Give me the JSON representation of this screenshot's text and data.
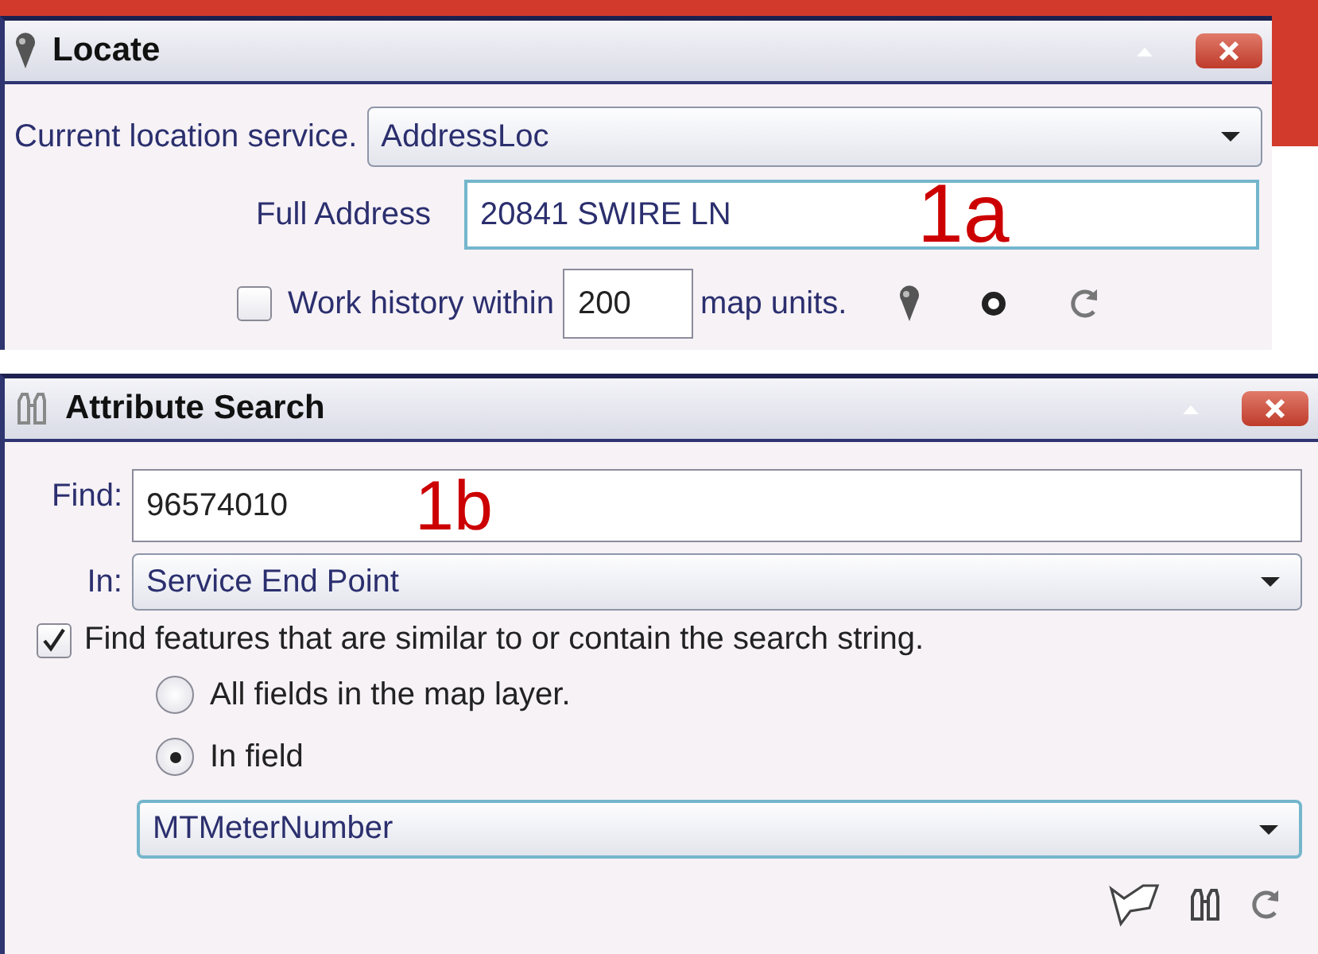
{
  "locate": {
    "title": "Locate",
    "service_label": "Current location service.",
    "service": "AddressLoc",
    "address_label": "Full Address",
    "address": "20841 SWIRE LN",
    "annotation": "1a",
    "history": {
      "checked": false,
      "label": "Work history within",
      "value": "200",
      "units": "map units."
    }
  },
  "attribute_search": {
    "title": "Attribute Search",
    "find_label": "Find:",
    "find": "96574010",
    "annotation": "1b",
    "in_label": "In:",
    "layer": "Service End Point",
    "similar": {
      "checked": true,
      "label": "Find features that are similar to or contain the search string."
    },
    "scope": [
      {
        "label": "All fields in the map layer.",
        "selected": false
      },
      {
        "label": "In field",
        "selected": true
      }
    ],
    "field": "MTMeterNumber"
  }
}
